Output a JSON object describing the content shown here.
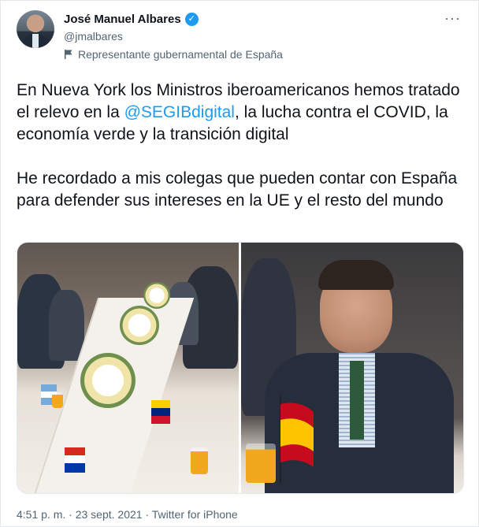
{
  "author": {
    "display_name": "José Manuel Albares",
    "handle": "@jmalbares",
    "verified_glyph": "✓",
    "label": "Representante gubernamental de España",
    "label_icon": "flag-icon"
  },
  "menu": {
    "more_glyph": "···"
  },
  "tweet": {
    "p1_before": "En Nueva York los Ministros iberoamericanos hemos tratado  el relevo en la ",
    "mention": "@SEGIBdigital",
    "p1_after": ", la lucha contra el COVID, la economía verde y la transición digital",
    "p2": "He recordado a mis colegas que pueden contar con España para defender sus intereses en la UE y el resto del mundo"
  },
  "media": [
    {
      "kind": "photo",
      "description_icon": "meeting-table-photo"
    },
    {
      "kind": "photo",
      "description_icon": "speaker-photo"
    }
  ],
  "footer": {
    "time": "4:51 p. m.",
    "separator1": " · ",
    "date": "23 sept. 2021",
    "separator2": " · ",
    "source": "Twitter for iPhone"
  },
  "colors": {
    "accent": "#1d9bf0",
    "text": "#0f1419",
    "secondary": "#536471",
    "border": "#e1e8ed"
  }
}
